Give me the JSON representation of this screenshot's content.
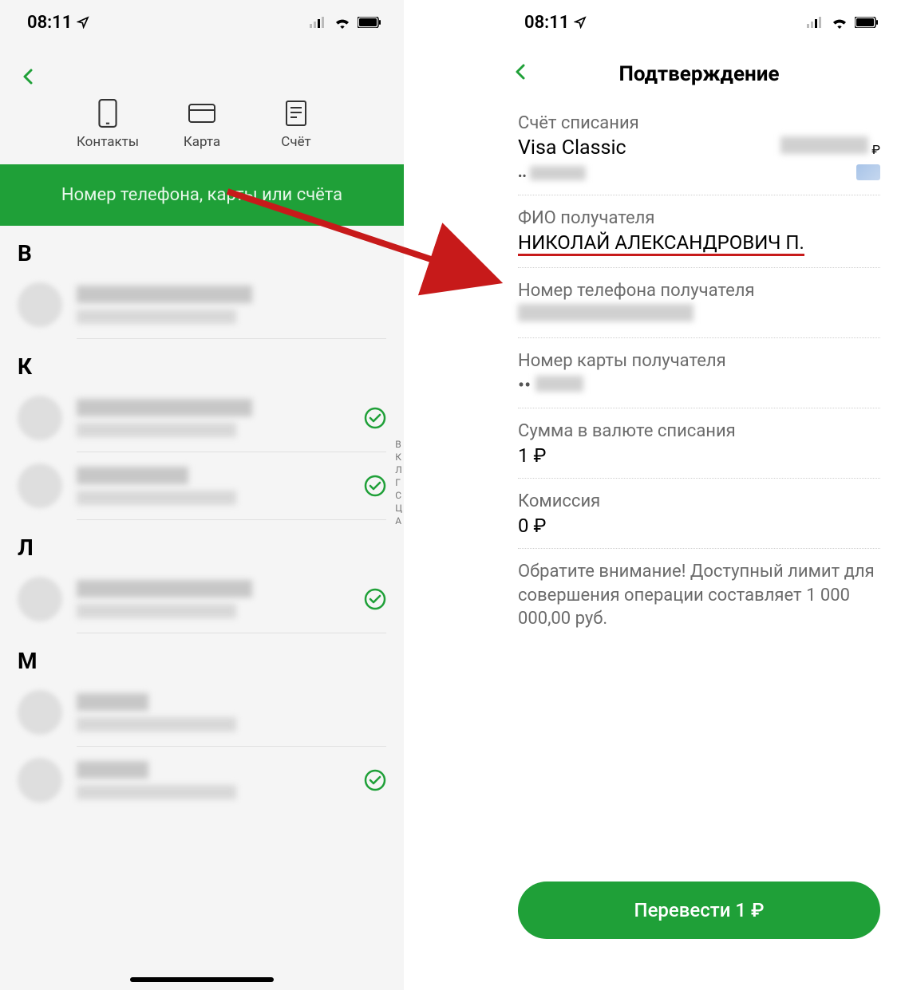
{
  "status": {
    "time": "08:11"
  },
  "left": {
    "tabs": {
      "contacts": "Контакты",
      "card": "Карта",
      "account": "Счёт"
    },
    "search_placeholder": "Номер телефона, карты или счёта",
    "sections": {
      "b": "В",
      "k": "К",
      "l": "Л",
      "m": "М"
    },
    "alpha_index": [
      "В",
      "К",
      "Л",
      "Г",
      "С",
      "Ц",
      "А"
    ]
  },
  "right": {
    "title": "Подтверждение",
    "account_from_label": "Счёт списания",
    "account_from_value": "Visa Classic",
    "currency": "₽",
    "recipient_name_label": "ФИО получателя",
    "recipient_name_value": "НИКОЛАЙ АЛЕКСАНДРОВИЧ П.",
    "recipient_phone_label": "Номер телефона получателя",
    "recipient_card_label": "Номер карты получателя",
    "amount_label": "Сумма в валюте списания",
    "amount_value": "1 ₽",
    "fee_label": "Комиссия",
    "fee_value": "0 ₽",
    "notice": "Обратите внимание! Доступный лимит для совершения операции составляет 1 000 000,00 руб.",
    "button": "Перевести 1 ₽"
  }
}
